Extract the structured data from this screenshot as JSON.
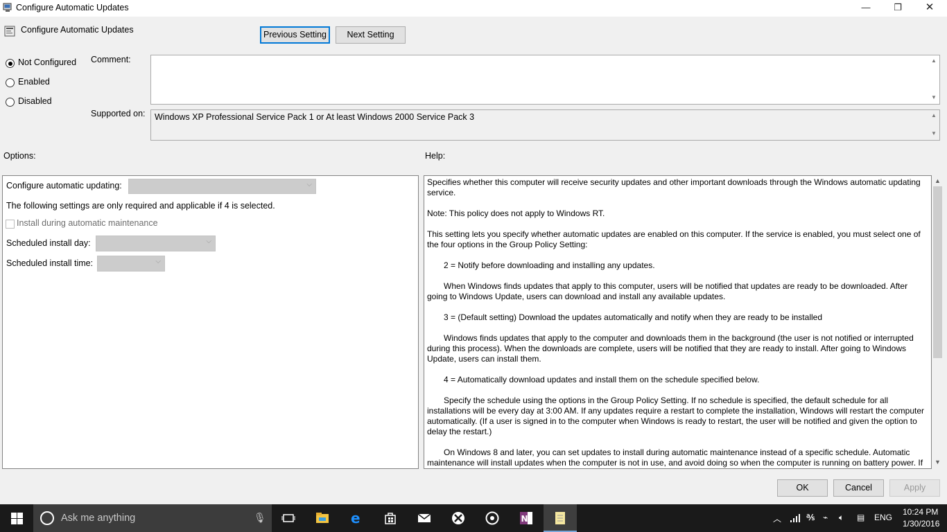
{
  "window": {
    "title": "Configure Automatic Updates",
    "minimize_glyph": "—",
    "maximize_glyph": "❐",
    "close_glyph": "✕"
  },
  "header": {
    "title": "Configure Automatic Updates",
    "prev_label": "Previous Setting",
    "next_label": "Next Setting"
  },
  "state": {
    "options": [
      {
        "label": "Not Configured",
        "checked": true
      },
      {
        "label": "Enabled",
        "checked": false
      },
      {
        "label": "Disabled",
        "checked": false
      }
    ]
  },
  "comment": {
    "label": "Comment:",
    "value": ""
  },
  "supported": {
    "label": "Supported on:",
    "value": "Windows XP Professional Service Pack 1 or At least Windows 2000 Service Pack 3"
  },
  "options_panel": {
    "label": "Options:",
    "configure_label": "Configure automatic updating:",
    "configure_value": "",
    "note": "The following settings are only required and applicable if 4 is selected.",
    "maintenance_label": "Install during automatic maintenance",
    "maintenance_checked": false,
    "day_label": "Scheduled install day:",
    "day_value": "",
    "time_label": "Scheduled install time:",
    "time_value": ""
  },
  "help_panel": {
    "label": "Help:",
    "paragraphs": [
      "Specifies whether this computer will receive security updates and other important downloads through the Windows automatic updating service.",
      "Note: This policy does not apply to Windows RT.",
      "This setting lets you specify whether automatic updates are enabled on this computer. If the service is enabled, you must select one of the four options in the Group Policy Setting:",
      "2 = Notify before downloading and installing any updates.",
      "When Windows finds updates that apply to this computer, users will be notified that updates are ready to be downloaded. After going to Windows Update, users can download and install any available updates.",
      "3 = (Default setting) Download the updates automatically and notify when they are ready to be installed",
      "Windows finds updates that apply to the computer and downloads them in the background (the user is not notified or interrupted during this process). When the downloads are complete, users will be notified that they are ready to install. After going to Windows Update, users can install them.",
      "4 = Automatically download updates and install them on the schedule specified below.",
      "Specify the schedule using the options in the Group Policy Setting. If no schedule is specified, the default schedule for all installations will be every day at 3:00 AM. If any updates require a restart to complete the installation, Windows will restart the computer automatically. (If a user is signed in to the computer when Windows is ready to restart, the user will be notified and given the option to delay the restart.)",
      "On Windows 8 and later, you can set updates to install during automatic maintenance instead of a specific schedule. Automatic maintenance will install updates when the computer is not in use, and avoid doing so when the computer is running on battery power. If"
    ]
  },
  "footer": {
    "ok_label": "OK",
    "cancel_label": "Cancel",
    "apply_label": "Apply"
  },
  "taskbar": {
    "search_placeholder": "Ask me anything",
    "icons": [
      "task-view-icon",
      "file-explorer-icon",
      "edge-icon",
      "store-icon",
      "mail-icon",
      "xbox-icon",
      "groove-music-icon",
      "onenote-icon",
      "notepad-icon"
    ],
    "tray_language": "ENG",
    "clock_time": "10:24 PM",
    "clock_date": "1/30/2016"
  }
}
